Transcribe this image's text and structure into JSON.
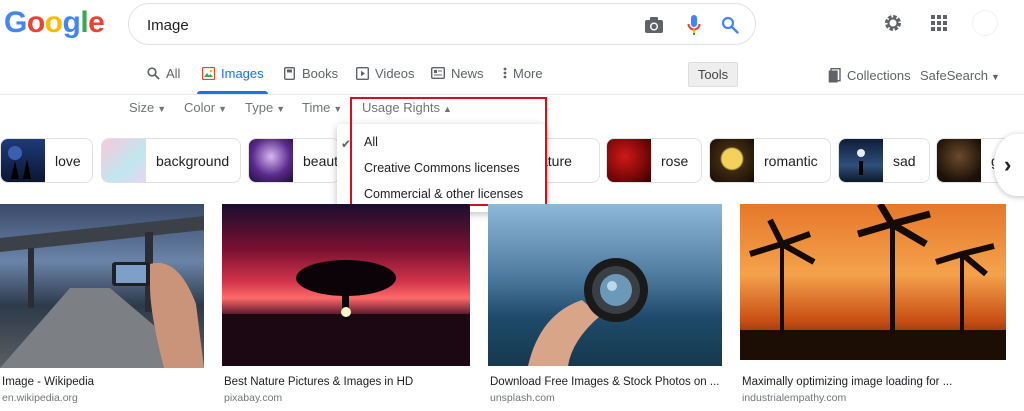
{
  "logo": {
    "letters": [
      "G",
      "o",
      "o",
      "g",
      "l",
      "e"
    ]
  },
  "search": {
    "value": "Image"
  },
  "tabs": [
    {
      "label": "All"
    },
    {
      "label": "Images"
    },
    {
      "label": "Books"
    },
    {
      "label": "Videos"
    },
    {
      "label": "News"
    },
    {
      "label": "More"
    }
  ],
  "tools_label": "Tools",
  "collections_label": "Collections",
  "safesearch_label": "SafeSearch",
  "filters": [
    {
      "label": "Size"
    },
    {
      "label": "Color"
    },
    {
      "label": "Type"
    },
    {
      "label": "Time"
    },
    {
      "label": "Usage Rights"
    }
  ],
  "chips": [
    {
      "label": "love"
    },
    {
      "label": "background"
    },
    {
      "label": "beaut"
    },
    {
      "label": "ature"
    },
    {
      "label": "rose"
    },
    {
      "label": "romantic"
    },
    {
      "label": "sad"
    },
    {
      "label": "g"
    }
  ],
  "usage_dropdown": {
    "options": [
      "All",
      "Creative Commons licenses",
      "Commercial & other licenses"
    ],
    "selected": "All"
  },
  "results": [
    {
      "title": "Image - Wikipedia",
      "source": "en.wikipedia.org"
    },
    {
      "title": "Best Nature Pictures & Images in HD",
      "source": "pixabay.com"
    },
    {
      "title": "Download Free Images & Stock Photos on ...",
      "source": "unsplash.com"
    },
    {
      "title": "Maximally optimizing image loading for ...",
      "source": "industrialempathy.com"
    }
  ],
  "colors": {
    "google_blue": "#4285f4",
    "google_red": "#ea4335",
    "google_yellow": "#fbbc05",
    "google_green": "#34a853",
    "active_tab": "#1a73e8",
    "highlight": "#d80e1f"
  }
}
